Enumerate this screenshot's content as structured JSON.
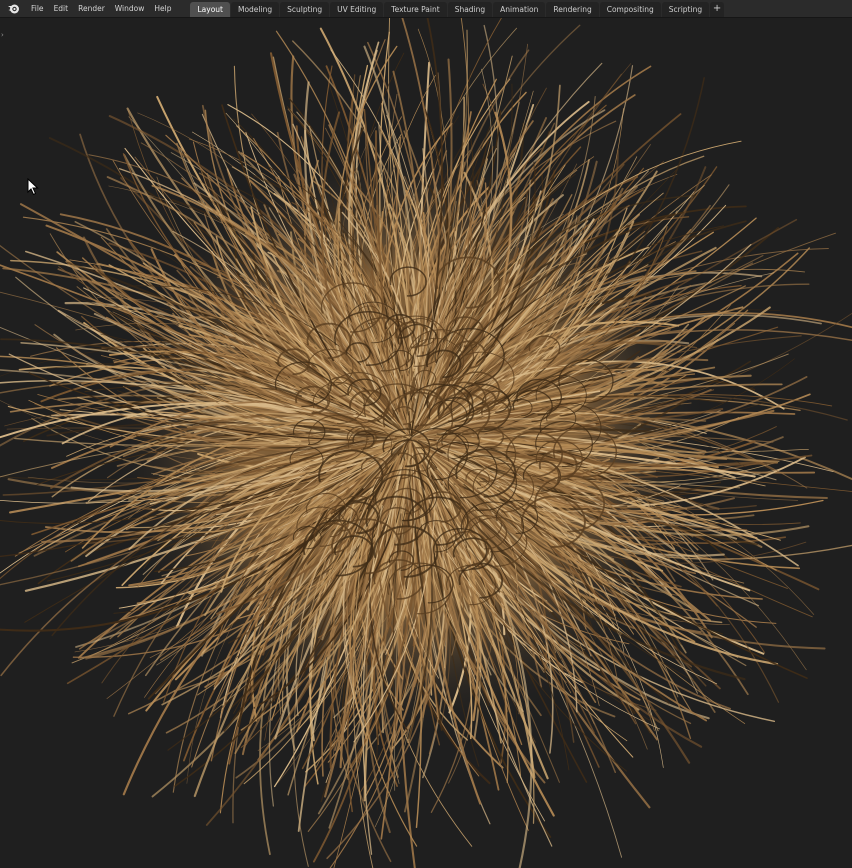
{
  "topbar": {
    "logo_icon": "blender-logo-icon",
    "menu": [
      {
        "label": "File"
      },
      {
        "label": "Edit"
      },
      {
        "label": "Render"
      },
      {
        "label": "Window"
      },
      {
        "label": "Help"
      }
    ],
    "workspace_tabs": [
      {
        "label": "Layout",
        "active": true
      },
      {
        "label": "Modeling",
        "active": false
      },
      {
        "label": "Sculpting",
        "active": false
      },
      {
        "label": "UV Editing",
        "active": false
      },
      {
        "label": "Texture Paint",
        "active": false
      },
      {
        "label": "Shading",
        "active": false
      },
      {
        "label": "Animation",
        "active": false
      },
      {
        "label": "Rendering",
        "active": false
      },
      {
        "label": "Compositing",
        "active": false
      },
      {
        "label": "Scripting",
        "active": false
      }
    ],
    "add_tab_label": "+"
  },
  "viewport": {
    "toolbar_toggle_label": "›",
    "cursor_icon": "mouse-pointer-icon",
    "object": "hair-fur-ball",
    "colors": {
      "background": "#1f1f1f",
      "hair_light": "#c9a46e",
      "hair_mid": "#9b7447",
      "hair_dark": "#3f2c17"
    }
  }
}
